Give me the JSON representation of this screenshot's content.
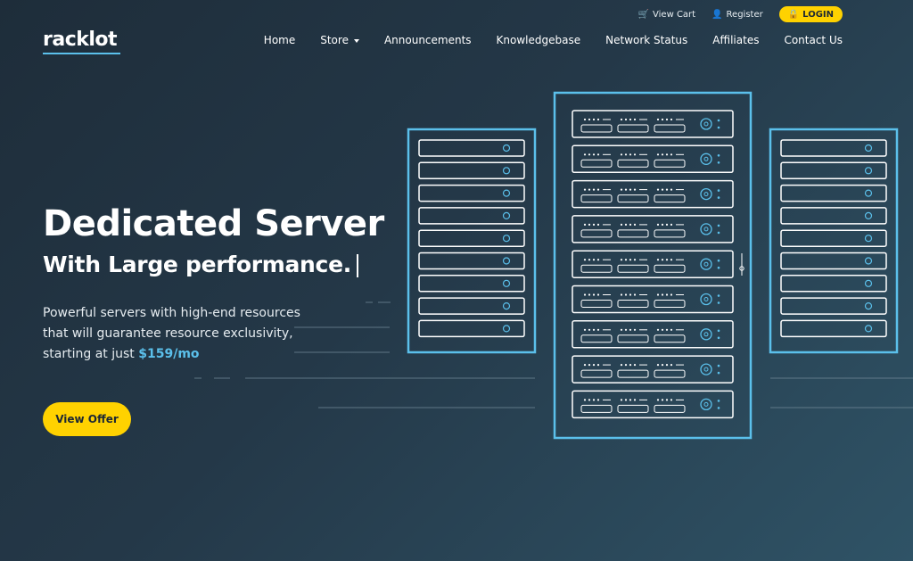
{
  "brand": {
    "name": "racklot"
  },
  "topbar": {
    "view_cart": "View Cart",
    "register": "Register",
    "login": "LOGIN"
  },
  "nav": {
    "items": [
      "Home",
      "Store",
      "Announcements",
      "Knowledgebase",
      "Network Status",
      "Affiliates",
      "Contact Us"
    ]
  },
  "hero": {
    "title": "Dedicated Server",
    "subtitle": "With Large performance.",
    "desc_line1": "Powerful servers with high-end resources",
    "desc_line2": "that will guarantee resource exclusivity,",
    "desc_line3": "starting at just",
    "price": "$159/mo",
    "cta": "View Offer"
  },
  "colors": {
    "accent_yellow": "#ffd200",
    "accent_blue": "#5bc0eb",
    "bg_dark": "#1e2d3a",
    "bg_light": "#2f5366"
  }
}
